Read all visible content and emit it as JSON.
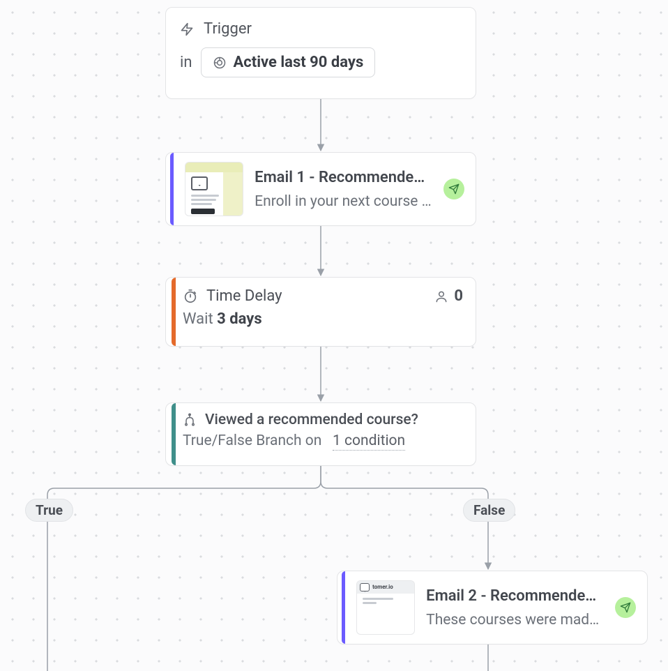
{
  "trigger": {
    "title": "Trigger",
    "in_label": "in",
    "segment": "Active last 90 days"
  },
  "email1": {
    "title": "Email 1 - Recommended c…",
    "subject": "Enroll in your next course today!"
  },
  "delay": {
    "title": "Time Delay",
    "people_count": "0",
    "wait_prefix": "Wait",
    "wait_value": "3 days"
  },
  "branch": {
    "question": "Viewed a recommended course?",
    "desc_prefix": "True/False Branch on",
    "condition_text": "1 condition",
    "true_label": "True",
    "false_label": "False"
  },
  "email2": {
    "brand": "tomer.io",
    "title": "Email 2 - Recommended c…",
    "subject": "These courses were made for …"
  }
}
